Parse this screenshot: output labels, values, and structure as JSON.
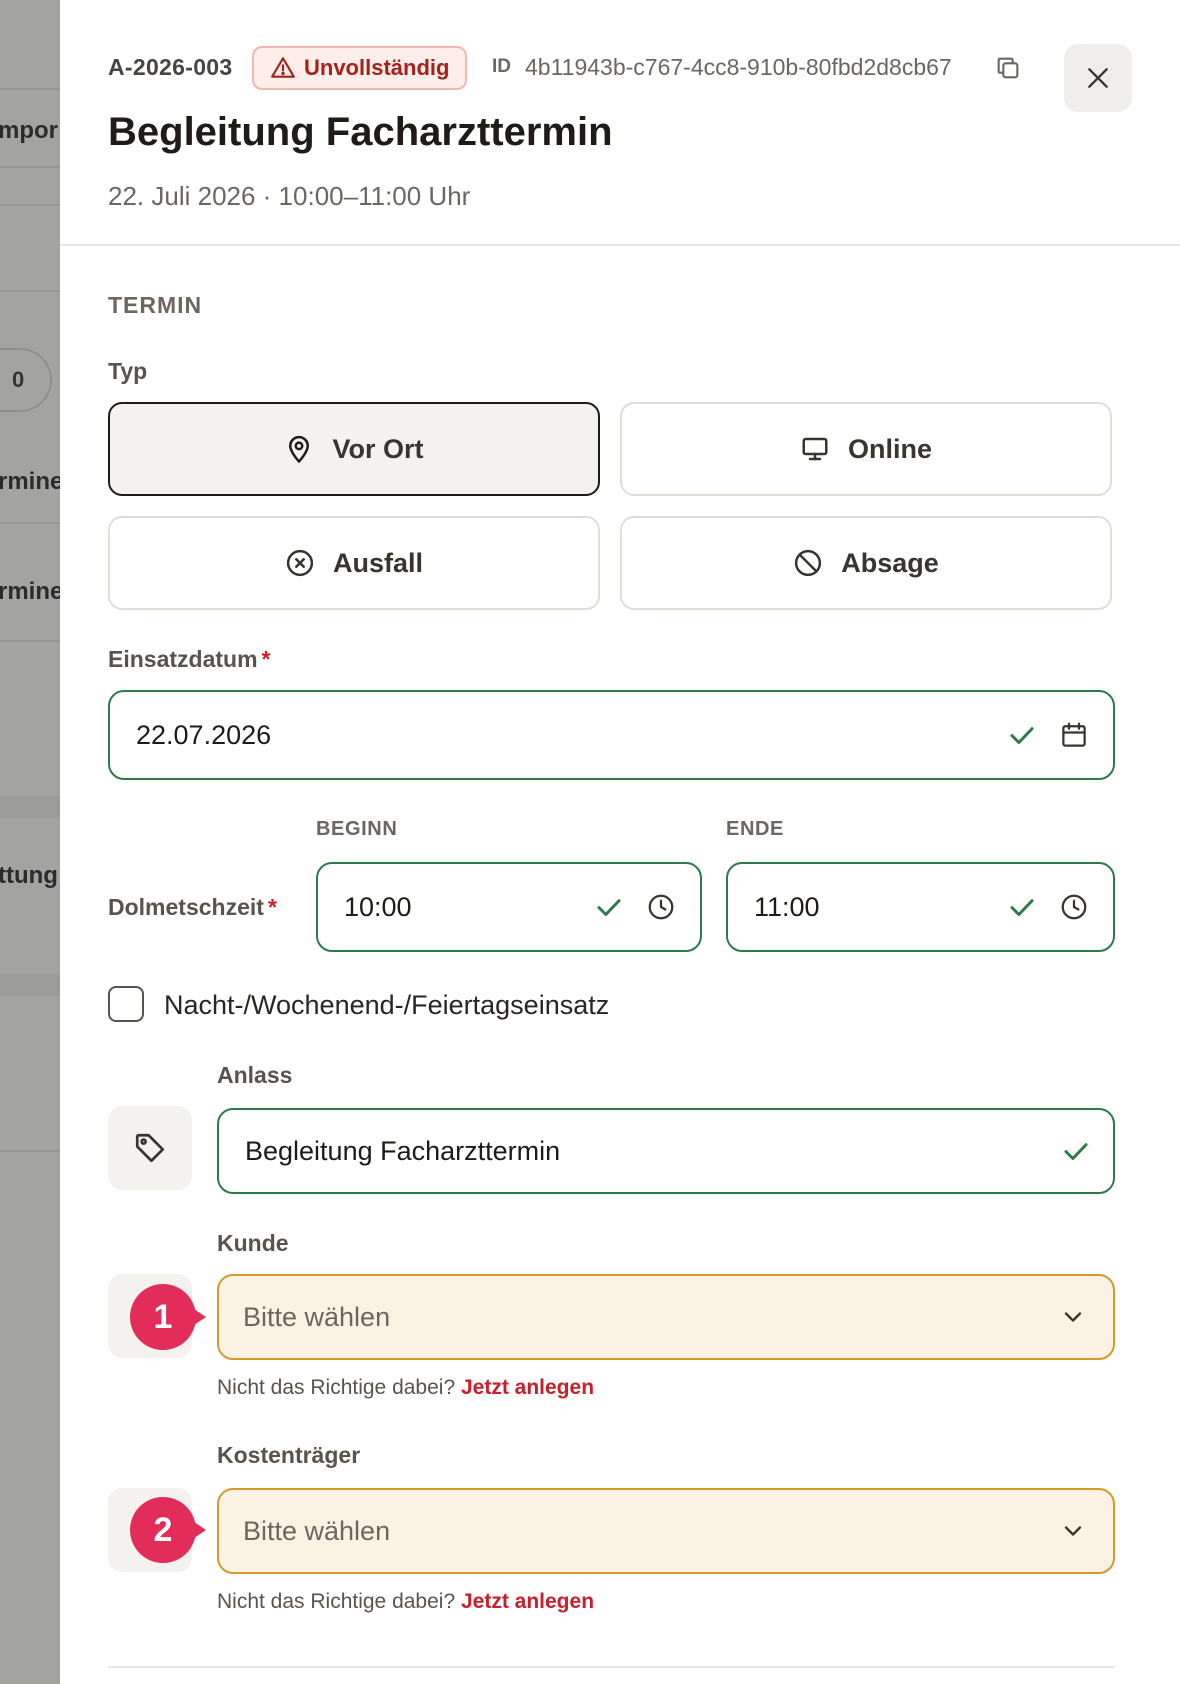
{
  "background": {
    "fragments": [
      "mpor",
      "0",
      "rmine",
      "rmine",
      "ttung"
    ]
  },
  "header": {
    "code": "A-2026-003",
    "status_badge": "Unvollständig",
    "id_label": "ID",
    "id_value": "4b11943b-c767-4cc8-910b-80fbd2d8cb67",
    "title": "Begleitung Facharzttermin",
    "subtitle": "22. Juli 2026 · 10:00–11:00 Uhr"
  },
  "termin": {
    "section_label": "TERMIN",
    "type_label": "Typ",
    "types": [
      {
        "label": "Vor Ort",
        "icon": "map-pin-icon",
        "selected": true
      },
      {
        "label": "Online",
        "icon": "monitor-icon",
        "selected": false
      },
      {
        "label": "Ausfall",
        "icon": "x-circle-icon",
        "selected": false
      },
      {
        "label": "Absage",
        "icon": "ban-icon",
        "selected": false
      }
    ],
    "date_label": "Einsatzdatum",
    "required_mark": "*",
    "date_value": "22.07.2026",
    "time_label": "Dolmetschzeit",
    "begin_label": "BEGINN",
    "begin_value": "10:00",
    "end_label": "ENDE",
    "end_value": "11:00",
    "night_checkbox_label": "Nacht-/Wochenend-/Feiertagseinsatz",
    "night_checked": false,
    "anlass_label": "Anlass",
    "anlass_value": "Begleitung Facharzttermin",
    "kunde_label": "Kunde",
    "kunde_placeholder": "Bitte wählen",
    "kunde_hint": "Nicht das Richtige dabei?",
    "kunde_hint_link": "Jetzt anlegen",
    "kosten_label": "Kostenträger",
    "kosten_placeholder": "Bitte wählen",
    "kosten_hint": "Nicht das Richtige dabei?",
    "kosten_hint_link": "Jetzt anlegen"
  },
  "markers": [
    "1",
    "2"
  ],
  "colors": {
    "valid_border": "#2e7a4a",
    "warning_border": "#d49a2a",
    "warning_bg": "#fcf2e3",
    "error_text": "#c8202a",
    "marker": "#e22d5a"
  }
}
